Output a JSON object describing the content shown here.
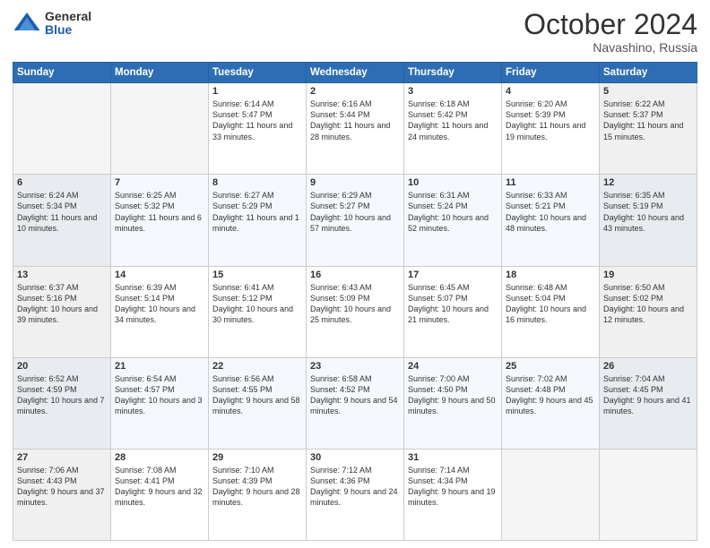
{
  "logo": {
    "general": "General",
    "blue": "Blue"
  },
  "header": {
    "month": "October 2024",
    "location": "Navashino, Russia"
  },
  "days_of_week": [
    "Sunday",
    "Monday",
    "Tuesday",
    "Wednesday",
    "Thursday",
    "Friday",
    "Saturday"
  ],
  "weeks": [
    [
      {
        "day": "",
        "sunrise": "",
        "sunset": "",
        "daylight": ""
      },
      {
        "day": "",
        "sunrise": "",
        "sunset": "",
        "daylight": ""
      },
      {
        "day": "1",
        "sunrise": "Sunrise: 6:14 AM",
        "sunset": "Sunset: 5:47 PM",
        "daylight": "Daylight: 11 hours and 33 minutes."
      },
      {
        "day": "2",
        "sunrise": "Sunrise: 6:16 AM",
        "sunset": "Sunset: 5:44 PM",
        "daylight": "Daylight: 11 hours and 28 minutes."
      },
      {
        "day": "3",
        "sunrise": "Sunrise: 6:18 AM",
        "sunset": "Sunset: 5:42 PM",
        "daylight": "Daylight: 11 hours and 24 minutes."
      },
      {
        "day": "4",
        "sunrise": "Sunrise: 6:20 AM",
        "sunset": "Sunset: 5:39 PM",
        "daylight": "Daylight: 11 hours and 19 minutes."
      },
      {
        "day": "5",
        "sunrise": "Sunrise: 6:22 AM",
        "sunset": "Sunset: 5:37 PM",
        "daylight": "Daylight: 11 hours and 15 minutes."
      }
    ],
    [
      {
        "day": "6",
        "sunrise": "Sunrise: 6:24 AM",
        "sunset": "Sunset: 5:34 PM",
        "daylight": "Daylight: 11 hours and 10 minutes."
      },
      {
        "day": "7",
        "sunrise": "Sunrise: 6:25 AM",
        "sunset": "Sunset: 5:32 PM",
        "daylight": "Daylight: 11 hours and 6 minutes."
      },
      {
        "day": "8",
        "sunrise": "Sunrise: 6:27 AM",
        "sunset": "Sunset: 5:29 PM",
        "daylight": "Daylight: 11 hours and 1 minute."
      },
      {
        "day": "9",
        "sunrise": "Sunrise: 6:29 AM",
        "sunset": "Sunset: 5:27 PM",
        "daylight": "Daylight: 10 hours and 57 minutes."
      },
      {
        "day": "10",
        "sunrise": "Sunrise: 6:31 AM",
        "sunset": "Sunset: 5:24 PM",
        "daylight": "Daylight: 10 hours and 52 minutes."
      },
      {
        "day": "11",
        "sunrise": "Sunrise: 6:33 AM",
        "sunset": "Sunset: 5:21 PM",
        "daylight": "Daylight: 10 hours and 48 minutes."
      },
      {
        "day": "12",
        "sunrise": "Sunrise: 6:35 AM",
        "sunset": "Sunset: 5:19 PM",
        "daylight": "Daylight: 10 hours and 43 minutes."
      }
    ],
    [
      {
        "day": "13",
        "sunrise": "Sunrise: 6:37 AM",
        "sunset": "Sunset: 5:16 PM",
        "daylight": "Daylight: 10 hours and 39 minutes."
      },
      {
        "day": "14",
        "sunrise": "Sunrise: 6:39 AM",
        "sunset": "Sunset: 5:14 PM",
        "daylight": "Daylight: 10 hours and 34 minutes."
      },
      {
        "day": "15",
        "sunrise": "Sunrise: 6:41 AM",
        "sunset": "Sunset: 5:12 PM",
        "daylight": "Daylight: 10 hours and 30 minutes."
      },
      {
        "day": "16",
        "sunrise": "Sunrise: 6:43 AM",
        "sunset": "Sunset: 5:09 PM",
        "daylight": "Daylight: 10 hours and 25 minutes."
      },
      {
        "day": "17",
        "sunrise": "Sunrise: 6:45 AM",
        "sunset": "Sunset: 5:07 PM",
        "daylight": "Daylight: 10 hours and 21 minutes."
      },
      {
        "day": "18",
        "sunrise": "Sunrise: 6:48 AM",
        "sunset": "Sunset: 5:04 PM",
        "daylight": "Daylight: 10 hours and 16 minutes."
      },
      {
        "day": "19",
        "sunrise": "Sunrise: 6:50 AM",
        "sunset": "Sunset: 5:02 PM",
        "daylight": "Daylight: 10 hours and 12 minutes."
      }
    ],
    [
      {
        "day": "20",
        "sunrise": "Sunrise: 6:52 AM",
        "sunset": "Sunset: 4:59 PM",
        "daylight": "Daylight: 10 hours and 7 minutes."
      },
      {
        "day": "21",
        "sunrise": "Sunrise: 6:54 AM",
        "sunset": "Sunset: 4:57 PM",
        "daylight": "Daylight: 10 hours and 3 minutes."
      },
      {
        "day": "22",
        "sunrise": "Sunrise: 6:56 AM",
        "sunset": "Sunset: 4:55 PM",
        "daylight": "Daylight: 9 hours and 58 minutes."
      },
      {
        "day": "23",
        "sunrise": "Sunrise: 6:58 AM",
        "sunset": "Sunset: 4:52 PM",
        "daylight": "Daylight: 9 hours and 54 minutes."
      },
      {
        "day": "24",
        "sunrise": "Sunrise: 7:00 AM",
        "sunset": "Sunset: 4:50 PM",
        "daylight": "Daylight: 9 hours and 50 minutes."
      },
      {
        "day": "25",
        "sunrise": "Sunrise: 7:02 AM",
        "sunset": "Sunset: 4:48 PM",
        "daylight": "Daylight: 9 hours and 45 minutes."
      },
      {
        "day": "26",
        "sunrise": "Sunrise: 7:04 AM",
        "sunset": "Sunset: 4:45 PM",
        "daylight": "Daylight: 9 hours and 41 minutes."
      }
    ],
    [
      {
        "day": "27",
        "sunrise": "Sunrise: 7:06 AM",
        "sunset": "Sunset: 4:43 PM",
        "daylight": "Daylight: 9 hours and 37 minutes."
      },
      {
        "day": "28",
        "sunrise": "Sunrise: 7:08 AM",
        "sunset": "Sunset: 4:41 PM",
        "daylight": "Daylight: 9 hours and 32 minutes."
      },
      {
        "day": "29",
        "sunrise": "Sunrise: 7:10 AM",
        "sunset": "Sunset: 4:39 PM",
        "daylight": "Daylight: 9 hours and 28 minutes."
      },
      {
        "day": "30",
        "sunrise": "Sunrise: 7:12 AM",
        "sunset": "Sunset: 4:36 PM",
        "daylight": "Daylight: 9 hours and 24 minutes."
      },
      {
        "day": "31",
        "sunrise": "Sunrise: 7:14 AM",
        "sunset": "Sunset: 4:34 PM",
        "daylight": "Daylight: 9 hours and 19 minutes."
      },
      {
        "day": "",
        "sunrise": "",
        "sunset": "",
        "daylight": ""
      },
      {
        "day": "",
        "sunrise": "",
        "sunset": "",
        "daylight": ""
      }
    ]
  ]
}
